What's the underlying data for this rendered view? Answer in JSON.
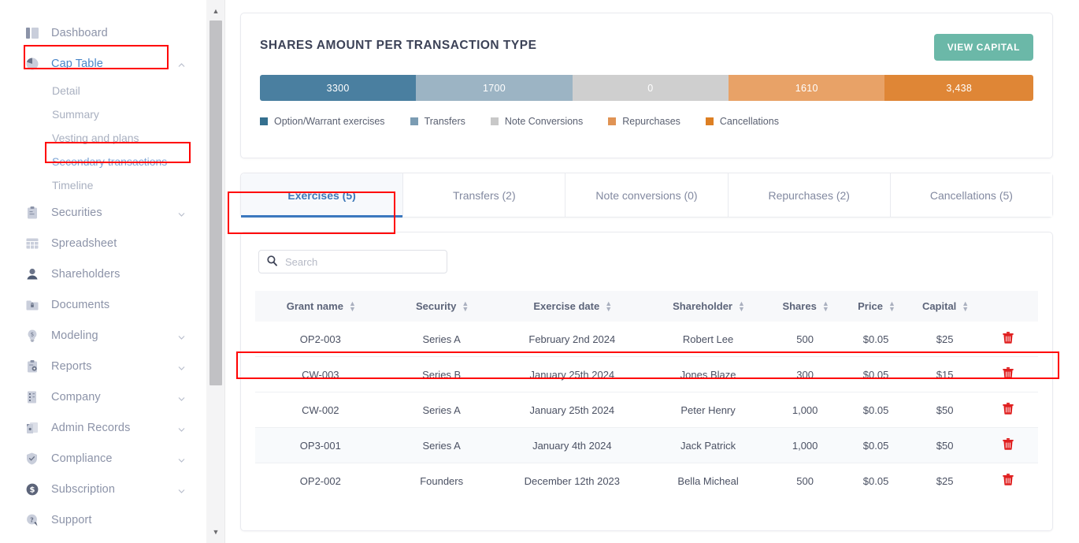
{
  "sidebar": {
    "items": [
      {
        "label": "Dashboard",
        "icon": "dashboard-icon",
        "expandable": false,
        "active": false,
        "highlighted": false
      },
      {
        "label": "Cap Table",
        "icon": "pie-chart-icon",
        "expandable": true,
        "expanded": true,
        "active": true,
        "highlighted": true
      },
      {
        "label": "Securities",
        "icon": "clipboard-icon",
        "expandable": true,
        "expanded": false,
        "active": false,
        "highlighted": false
      },
      {
        "label": "Spreadsheet",
        "icon": "table-icon",
        "expandable": false,
        "active": false,
        "highlighted": false
      },
      {
        "label": "Shareholders",
        "icon": "user-icon",
        "expandable": false,
        "active": false,
        "highlighted": false
      },
      {
        "label": "Documents",
        "icon": "folder-lock-icon",
        "expandable": false,
        "active": false,
        "highlighted": false
      },
      {
        "label": "Modeling",
        "icon": "lightbulb-dollar-icon",
        "expandable": true,
        "expanded": false,
        "active": false,
        "highlighted": false
      },
      {
        "label": "Reports",
        "icon": "report-gear-icon",
        "expandable": true,
        "expanded": false,
        "active": false,
        "highlighted": false
      },
      {
        "label": "Company",
        "icon": "building-icon",
        "expandable": true,
        "expanded": false,
        "active": false,
        "highlighted": false
      },
      {
        "label": "Admin Records",
        "icon": "records-icon",
        "expandable": true,
        "expanded": false,
        "active": false,
        "highlighted": false
      },
      {
        "label": "Compliance",
        "icon": "shield-check-icon",
        "expandable": true,
        "expanded": false,
        "active": false,
        "highlighted": false
      },
      {
        "label": "Subscription",
        "icon": "dollar-circle-icon",
        "expandable": true,
        "expanded": false,
        "active": false,
        "highlighted": false
      },
      {
        "label": "Support",
        "icon": "help-chat-icon",
        "expandable": false,
        "active": false,
        "highlighted": false
      }
    ],
    "cap_table_subitems": [
      {
        "label": "Detail",
        "selected": false,
        "highlighted": false
      },
      {
        "label": "Summary",
        "selected": false,
        "highlighted": false
      },
      {
        "label": "Vesting and plans",
        "selected": false,
        "highlighted": false
      },
      {
        "label": "Secondary transactions",
        "selected": true,
        "highlighted": true
      },
      {
        "label": "Timeline",
        "selected": false,
        "highlighted": false
      }
    ]
  },
  "chart_card": {
    "title": "SHARES AMOUNT PER TRANSACTION TYPE",
    "view_capital_label": "VIEW CAPITAL",
    "view_capital_color": "#6bb8a8"
  },
  "chart_data": {
    "type": "bar",
    "orientation": "horizontal-stacked",
    "title": "SHARES AMOUNT PER TRANSACTION TYPE",
    "categories": [
      "Option/Warrant exercises",
      "Transfers",
      "Note Conversions",
      "Repurchases",
      "Cancellations"
    ],
    "values": [
      3300,
      1700,
      0,
      1610,
      3438
    ],
    "value_labels": [
      "3300",
      "1700",
      "0",
      "1610",
      "3,438"
    ],
    "colors": [
      "#4a7fa0",
      "#9cb4c4",
      "#cfcfcf",
      "#e8a267",
      "#df8636"
    ],
    "segment_widths_pct": [
      20.2,
      20.2,
      20.2,
      20.2,
      19.2
    ],
    "legend_position": "bottom-left",
    "grid": false,
    "xlabel": "",
    "ylabel": ""
  },
  "tabs": [
    {
      "label": "Exercises (5)",
      "active": true,
      "highlighted": true
    },
    {
      "label": "Transfers (2)",
      "active": false,
      "highlighted": false
    },
    {
      "label": "Note conversions (0)",
      "active": false,
      "highlighted": false
    },
    {
      "label": "Repurchases (2)",
      "active": false,
      "highlighted": false
    },
    {
      "label": "Cancellations (5)",
      "active": false,
      "highlighted": false
    }
  ],
  "search": {
    "value": "",
    "placeholder": "Search",
    "icon": "search-icon"
  },
  "table": {
    "columns": [
      {
        "label": "Grant name",
        "sortable": true
      },
      {
        "label": "Security",
        "sortable": true
      },
      {
        "label": "Exercise date",
        "sortable": true
      },
      {
        "label": "Shareholder",
        "sortable": true
      },
      {
        "label": "Shares",
        "sortable": true
      },
      {
        "label": "Price",
        "sortable": true
      },
      {
        "label": "Capital",
        "sortable": true
      },
      {
        "label": "",
        "sortable": false
      }
    ],
    "rows": [
      {
        "grant_name": "OP2-003",
        "security": "Series A",
        "exercise_date": "February 2nd 2024",
        "shareholder": "Robert Lee",
        "shares": "500",
        "price": "$0.05",
        "capital": "$25",
        "action": "delete-icon",
        "highlighted": true
      },
      {
        "grant_name": "CW-003",
        "security": "Series B",
        "exercise_date": "January 25th 2024",
        "shareholder": "Jones Blaze",
        "shares": "300",
        "price": "$0.05",
        "capital": "$15",
        "action": "delete-icon",
        "highlighted": false
      },
      {
        "grant_name": "CW-002",
        "security": "Series A",
        "exercise_date": "January 25th 2024",
        "shareholder": "Peter Henry",
        "shares": "1,000",
        "price": "$0.05",
        "capital": "$50",
        "action": "delete-icon",
        "highlighted": false
      },
      {
        "grant_name": "OP3-001",
        "security": "Series A",
        "exercise_date": "January 4th 2024",
        "shareholder": "Jack Patrick",
        "shares": "1,000",
        "price": "$0.05",
        "capital": "$50",
        "action": "delete-icon",
        "highlighted": false
      },
      {
        "grant_name": "OP2-002",
        "security": "Founders",
        "exercise_date": "December 12th 2023",
        "shareholder": "Bella Micheal",
        "shares": "500",
        "price": "$0.05",
        "capital": "$25",
        "action": "delete-icon",
        "highlighted": false
      }
    ]
  },
  "scrollbar": {
    "up_arrow": "▲",
    "down_arrow": "▼"
  }
}
